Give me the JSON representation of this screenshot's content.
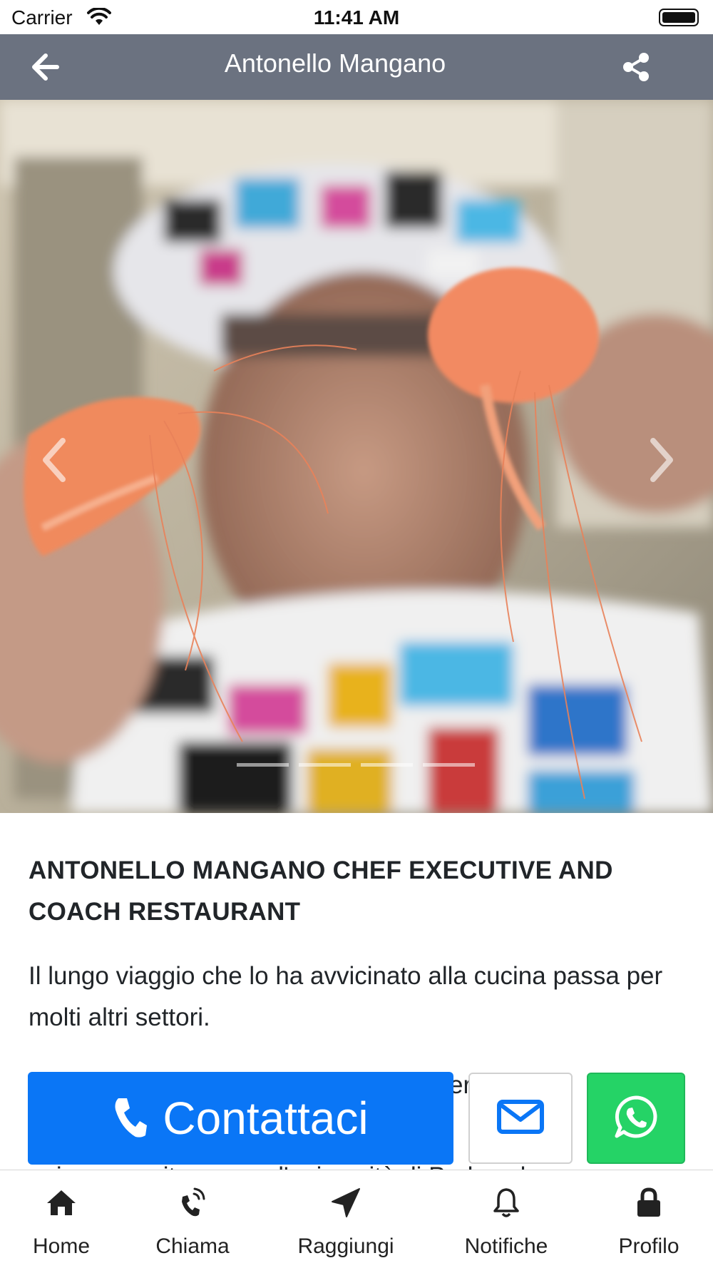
{
  "status_bar": {
    "carrier": "Carrier",
    "time": "11:41 AM"
  },
  "nav": {
    "title": "Antonello Mangano",
    "background": "#6b7280"
  },
  "carousel": {
    "slides": 4,
    "active": 0
  },
  "content": {
    "headline": "ANTONELLO MANGANO CHEF EXECUTIVE AND COACH RESTAURANT",
    "intro": "Il lungo viaggio che lo ha avvicinato alla cucina passa per molti altri settori.",
    "partial_line_1": "er",
    "partial_line_2": "poi conseguito presso l'università di Padova laurea"
  },
  "actions": {
    "contact_label": "Contattaci",
    "contact_color": "#0a76f6",
    "email_icon": "envelope-icon",
    "whatsapp_icon": "whatsapp-icon",
    "whatsapp_color": "#25d366"
  },
  "tabs": [
    {
      "label": "Home",
      "icon": "home-icon"
    },
    {
      "label": "Chiama",
      "icon": "phone-ringing-icon"
    },
    {
      "label": "Raggiungi",
      "icon": "location-arrow-icon"
    },
    {
      "label": "Notifiche",
      "icon": "bell-icon"
    },
    {
      "label": "Profilo",
      "icon": "lock-icon"
    }
  ]
}
